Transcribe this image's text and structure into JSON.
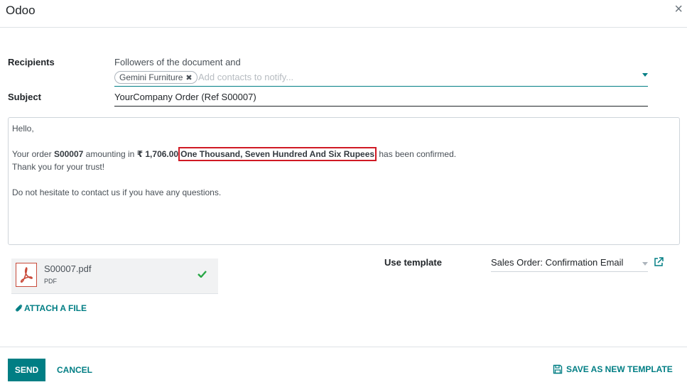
{
  "window": {
    "title": "Odoo",
    "close_glyph": "×"
  },
  "recipients": {
    "label": "Recipients",
    "prefix_text": "Followers of the document and",
    "tags": [
      {
        "label": "Gemini Furniture",
        "remove_glyph": "✖"
      }
    ],
    "placeholder": "Add contacts to notify..."
  },
  "subject": {
    "label": "Subject",
    "value": "YourCompany Order (Ref S00007)"
  },
  "body": {
    "greeting": "Hello,",
    "line1": {
      "pre": "Your order ",
      "order": "S00007",
      "mid": " amounting in ",
      "amount": "₹ 1,706.00",
      "words": "One Thousand, Seven Hundred And Six Rupees",
      "post": " has been confirmed."
    },
    "line2": "Thank you for your trust!",
    "line3": "Do not hesitate to contact us if you have any questions."
  },
  "attachment": {
    "name": "S00007.pdf",
    "type": "PDF",
    "icon": "pdf-file-icon",
    "status_icon": "check-icon"
  },
  "attach_file_label": "ATTACH A FILE",
  "template": {
    "label": "Use template",
    "selected": "Sales Order: Confirmation Email"
  },
  "footer": {
    "send_label": "SEND",
    "cancel_label": "CANCEL",
    "save_template_label": "SAVE AS NEW TEMPLATE"
  },
  "colors": {
    "accent": "#017e84",
    "highlight_border": "#d01a24",
    "pdf_red": "#c84a3a",
    "check_green": "#28a745"
  }
}
